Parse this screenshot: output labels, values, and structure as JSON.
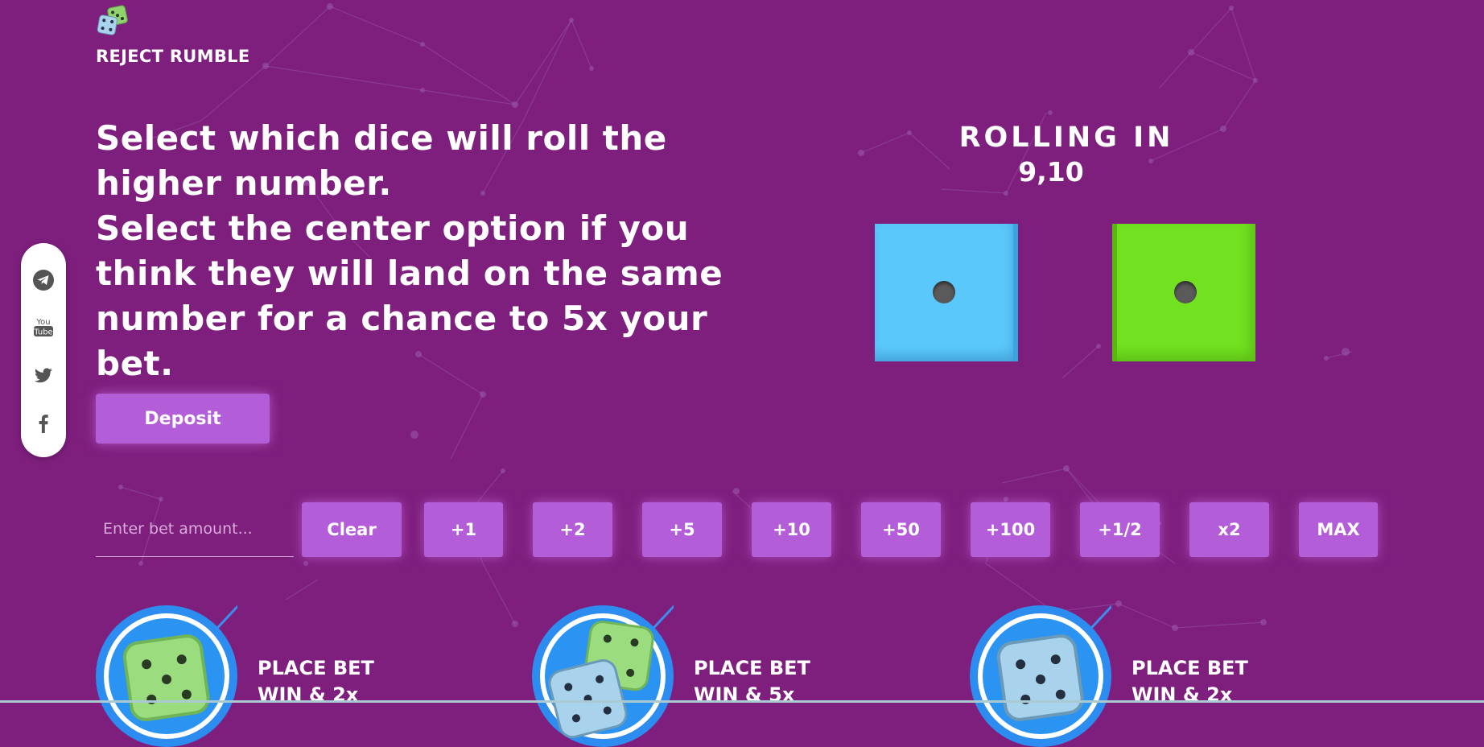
{
  "app": {
    "title": "REJECT RUMBLE",
    "logo_icon": "dice-pair-icon"
  },
  "instructions": {
    "line1": "Select which dice will roll the higher number.",
    "line2": "Select the center option if you think they will land on the same number for a chance to 5x your bet."
  },
  "deposit": {
    "label": "Deposit"
  },
  "social": {
    "items": [
      {
        "name": "telegram",
        "icon": "telegram-icon"
      },
      {
        "name": "youtube",
        "icon": "youtube-icon"
      },
      {
        "name": "twitter",
        "icon": "twitter-icon"
      },
      {
        "name": "facebook",
        "icon": "facebook-icon"
      }
    ]
  },
  "rolling": {
    "label": "ROLLING IN",
    "value": "9,10"
  },
  "dice": {
    "left": {
      "color": "#5bc8fb",
      "face": 1
    },
    "right": {
      "color": "#72e11f",
      "face": 1
    }
  },
  "bet": {
    "placeholder": "Enter bet amount...",
    "value": "",
    "buttons": {
      "clear": "Clear",
      "plus1": "+1",
      "plus2": "+2",
      "plus5": "+5",
      "plus10": "+10",
      "plus50": "+50",
      "plus100": "+100",
      "half": "+1/2",
      "double": "x2",
      "max": "MAX"
    }
  },
  "options": [
    {
      "title": "PLACE BET",
      "subtitle": "WIN & 2x",
      "dice": "green-die-icon"
    },
    {
      "title": "PLACE BET",
      "subtitle": "WIN & 5x",
      "dice": "green-and-blue-dice-icon"
    },
    {
      "title": "PLACE BET",
      "subtitle": "WIN & 2x",
      "dice": "blue-die-icon"
    }
  ],
  "colors": {
    "background": "#7e1f7e",
    "button": "#b35ed8",
    "blue_die": "#5bc8fb",
    "green_die": "#72e11f",
    "option_ring": "#2d8cf0"
  }
}
